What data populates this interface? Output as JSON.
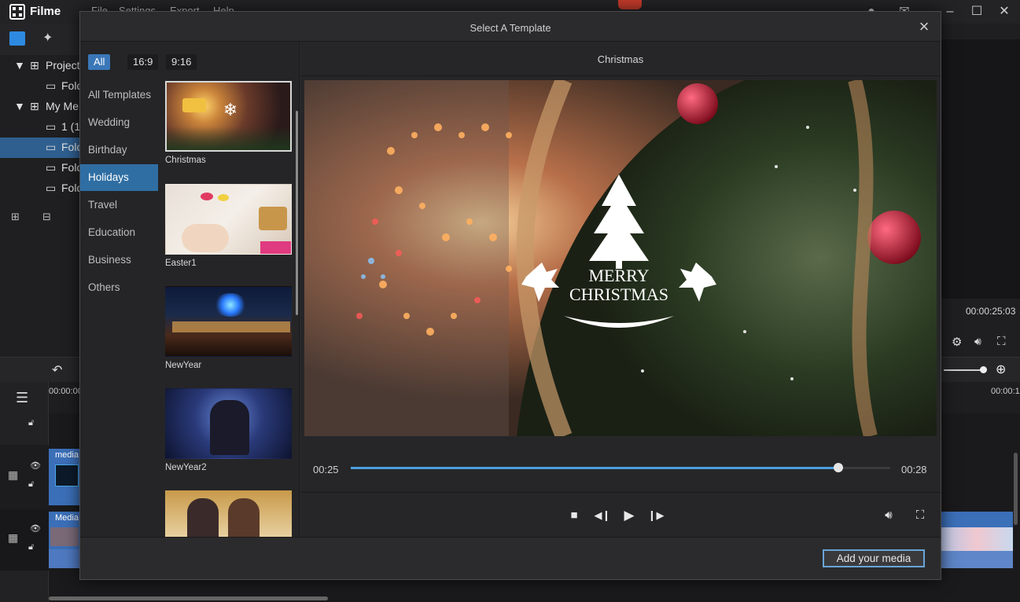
{
  "app": {
    "name": "Filme",
    "menu": [
      "File",
      "Settings",
      "Export",
      "Help"
    ]
  },
  "project_tree": {
    "items": [
      {
        "label": "Project",
        "level": 0,
        "selected": false
      },
      {
        "label": "Fold",
        "level": 1,
        "selected": false
      },
      {
        "label": "My Me",
        "level": 0,
        "selected": false
      },
      {
        "label": "1 (1",
        "level": 1,
        "selected": false
      },
      {
        "label": "Fold",
        "level": 1,
        "selected": true
      },
      {
        "label": "Fold",
        "level": 1,
        "selected": false
      },
      {
        "label": "Fold",
        "level": 1,
        "selected": false
      }
    ]
  },
  "player": {
    "timecode": "00:00:25:03"
  },
  "timeline": {
    "ruler_start": "00:00:00",
    "ruler_end": "00:00:1",
    "track_labels": [
      "media",
      "Media"
    ]
  },
  "modal": {
    "title": "Select A Template",
    "ratios": [
      {
        "label": "All",
        "active": true
      },
      {
        "label": "16:9",
        "active": false
      },
      {
        "label": "9:16",
        "active": false
      }
    ],
    "categories": [
      {
        "label": "All Templates",
        "active": false
      },
      {
        "label": "Wedding",
        "active": false
      },
      {
        "label": "Birthday",
        "active": false
      },
      {
        "label": "Holidays",
        "active": true
      },
      {
        "label": "Travel",
        "active": false
      },
      {
        "label": "Education",
        "active": false
      },
      {
        "label": "Business",
        "active": false
      },
      {
        "label": "Others",
        "active": false
      }
    ],
    "templates": [
      {
        "label": "Christmas",
        "selected": true
      },
      {
        "label": "Easter1",
        "selected": false
      },
      {
        "label": "NewYear",
        "selected": false
      },
      {
        "label": "NewYear2",
        "selected": false
      },
      {
        "label": "",
        "selected": false
      }
    ],
    "preview": {
      "title": "Christmas",
      "overlay_line1": "MERRY",
      "overlay_line2": "CHRISTMAS",
      "current_time": "00:25",
      "total_time": "00:28",
      "progress": 0.904
    },
    "add_media_label": "Add your media"
  },
  "colors": {
    "accent": "#3a77b8",
    "progress": "#4a9fe0",
    "selected_category": "#2f6ea3"
  }
}
